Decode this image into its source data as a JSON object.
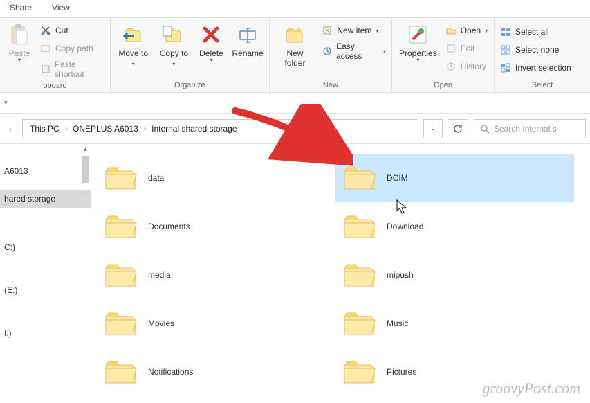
{
  "tabs": {
    "share": "Share",
    "view": "View"
  },
  "ribbon": {
    "clipboard": {
      "title": "oboard",
      "paste": "Paste",
      "cut": "Cut",
      "copy_path": "Copy path",
      "paste_shortcut": "Paste shortcut"
    },
    "organize": {
      "title": "Organize",
      "move_to": "Move\nto",
      "copy_to": "Copy\nto",
      "delete": "Delete",
      "rename": "Rename"
    },
    "new": {
      "title": "New",
      "new_folder": "New\nfolder",
      "new_item": "New item",
      "easy_access": "Easy access"
    },
    "open": {
      "title": "Open",
      "properties": "Properties",
      "open": "Open",
      "edit": "Edit",
      "history": "History"
    },
    "select": {
      "title": "Select",
      "select_all": "Select all",
      "select_none": "Select none",
      "invert": "Invert selection"
    }
  },
  "breadcrumbs": {
    "this_pc": "This PC",
    "device": "ONEPLUS A6013",
    "storage": "Internal shared storage"
  },
  "search_placeholder": "Search Internal s",
  "sidebar": {
    "device": "A6013",
    "storage": "hared storage",
    "c": "C:)",
    "e": "(E:)",
    "i": "I:)"
  },
  "folders": [
    "data",
    "DCIM",
    "Documents",
    "Download",
    "media",
    "mipush",
    "Movies",
    "Music",
    "Notifications",
    "Pictures"
  ],
  "selected_folder": "DCIM",
  "watermark": "groovyPost.com"
}
